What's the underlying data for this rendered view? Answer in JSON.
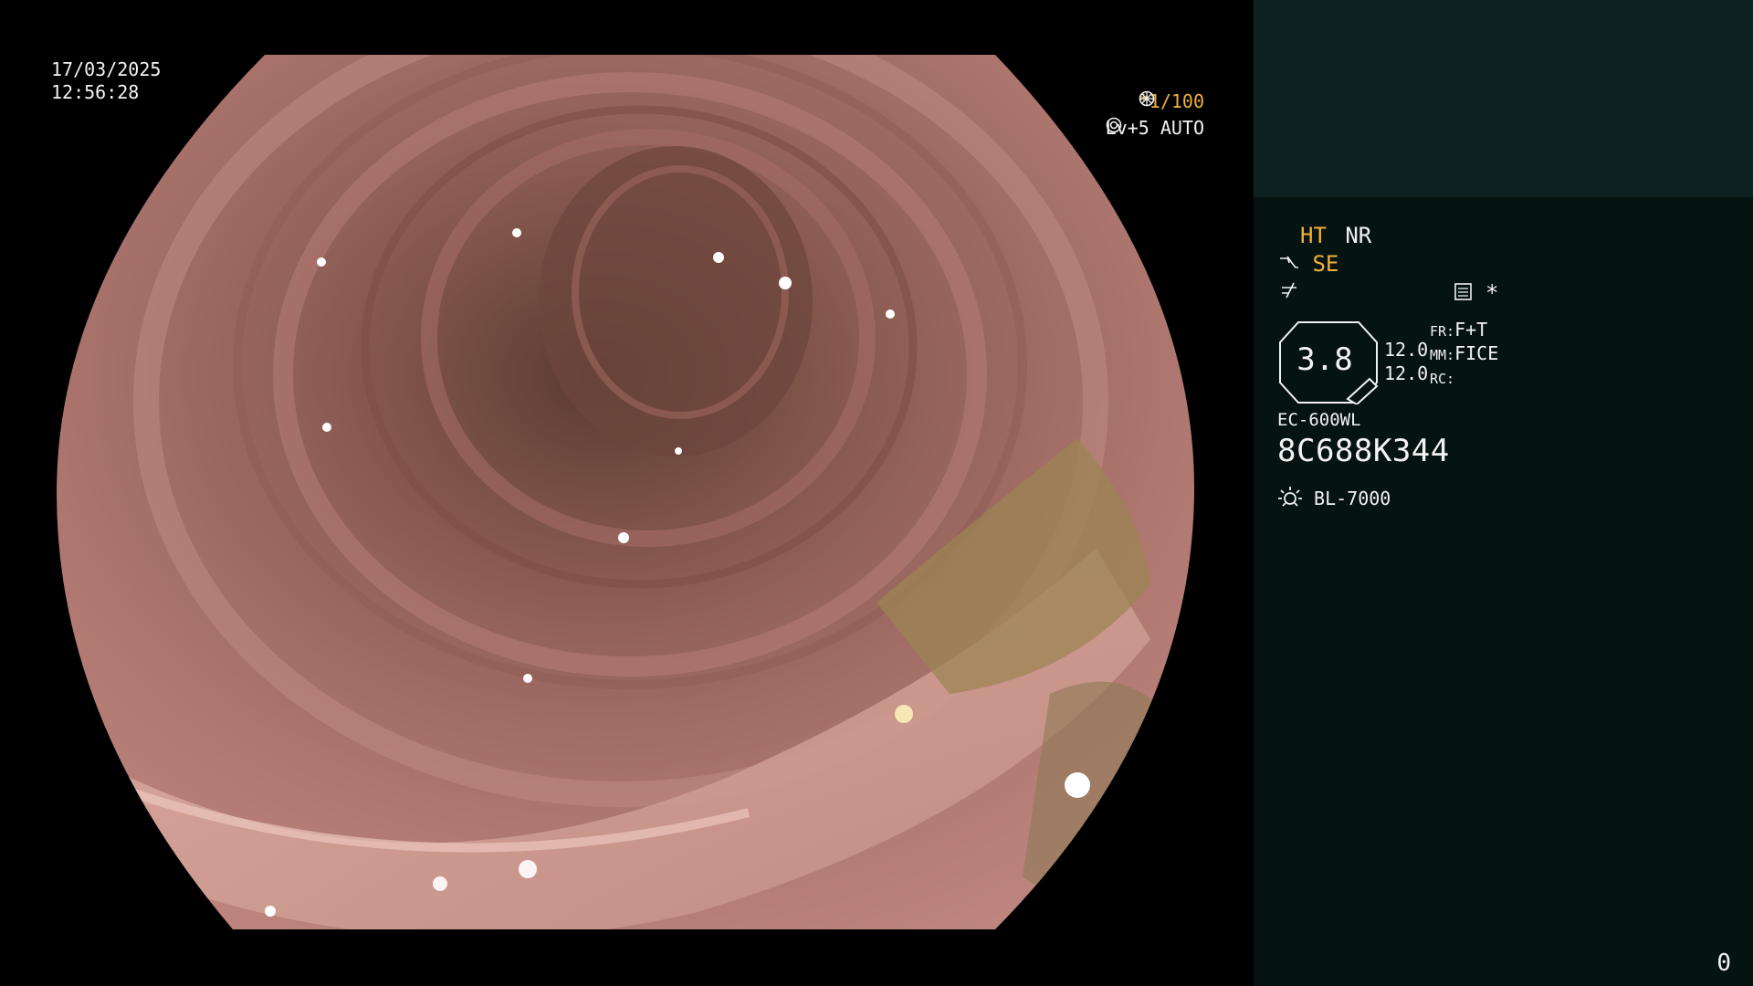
{
  "overlay": {
    "date": "17/03/2025",
    "time": "12:56:28",
    "shutter": "*1/100",
    "shutter_icon": "shutter-icon",
    "level": "Lv+5 AUTO",
    "level_icon": "iris-icon"
  },
  "panel": {
    "row1": {
      "ht": "HT",
      "nr": "NR"
    },
    "row2": {
      "icon": "structure-enhance-icon",
      "se": "SE"
    },
    "row3": {
      "icon": "color-mode-icon",
      "settings_icon": "settings-icon",
      "star": "*"
    },
    "zoom": {
      "value": "3.8"
    },
    "stats": {
      "v1": "12.0",
      "v2": "12.0",
      "fr_label": "FR:",
      "fr_value": "F+T",
      "mm_label": "MM:",
      "mm_value": "FICE",
      "rc_label": "RC:",
      "rc_value": ""
    },
    "scope_model": "EC-600WL",
    "scope_serial": "8C688K344",
    "light_icon": "light-source-icon",
    "light_source": "BL-7000",
    "page_number": "0"
  },
  "colors": {
    "accent_orange": "#f0b03a",
    "panel_bg": "#051411",
    "panel_top_bg": "#0e2321",
    "mucosa": "#b57872"
  }
}
